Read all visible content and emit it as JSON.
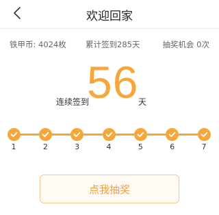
{
  "header": {
    "title": "欢迎回家"
  },
  "stats": {
    "coins": "铁甲币: 4024枚",
    "total_checkins": "累计签到285天",
    "lottery_chances": "抽奖机会 0次"
  },
  "streak": {
    "label": "连续签到",
    "days": "56",
    "unit": "天"
  },
  "timeline": {
    "days": [
      "1",
      "2",
      "3",
      "4",
      "5",
      "6",
      "7"
    ],
    "completed": [
      true,
      true,
      true,
      true,
      true,
      true,
      true
    ]
  },
  "lottery_button": {
    "label": "点我抽奖"
  },
  "colors": {
    "accent": "#f5a73a",
    "button_text": "#f0a040",
    "button_border": "#f3c891"
  },
  "icons": {
    "back": "chevron-left-icon",
    "check": "check-icon"
  }
}
